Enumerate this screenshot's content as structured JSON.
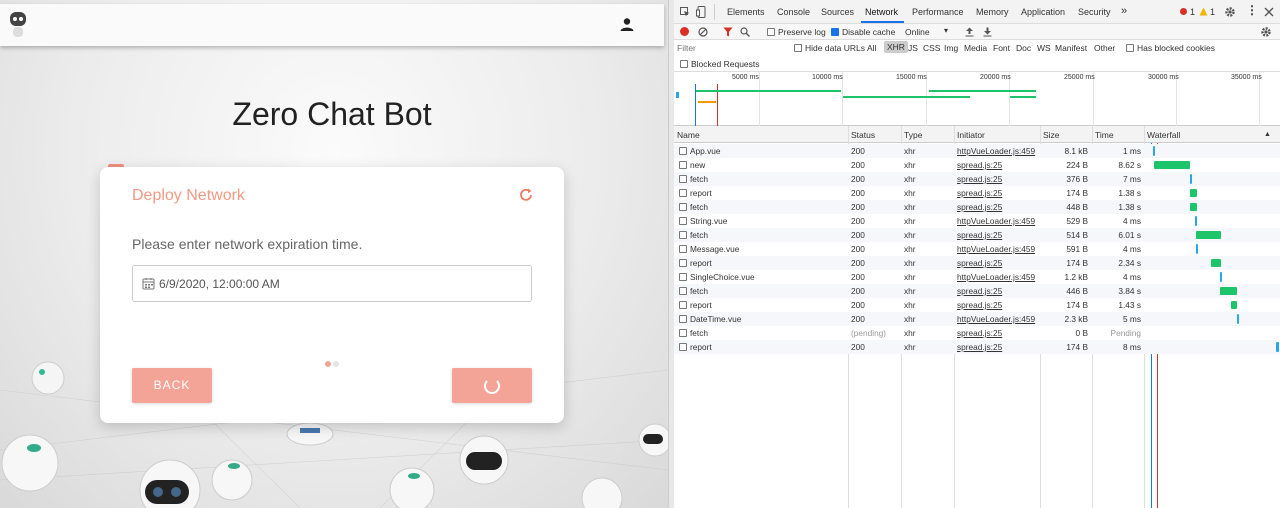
{
  "app": {
    "title": "Zero Chat Bot",
    "card": {
      "title": "Deploy Network",
      "prompt": "Please enter network expiration time.",
      "date_value": "6/9/2020, 12:00:00 AM",
      "back_label": "BACK"
    },
    "accent": "#f4a497",
    "icons": {
      "logo": "robot-logo-icon",
      "user": "person-icon",
      "refresh": "refresh-icon",
      "calendar": "calendar-icon",
      "spinner": "loading-spinner-icon"
    }
  },
  "devtools": {
    "tabs": [
      "Elements",
      "Console",
      "Sources",
      "Network",
      "Performance",
      "Memory",
      "Application",
      "Security"
    ],
    "active_tab": "Network",
    "more": "»",
    "errors": "1",
    "warnings": "1",
    "toolbar": {
      "preserve_log": "Preserve log",
      "disable_cache": "Disable cache",
      "throttle": "Online",
      "disable_cache_checked": true
    },
    "filter": {
      "placeholder": "Filter",
      "hide_data_urls": "Hide data URLs",
      "types": [
        "All",
        "XHR",
        "JS",
        "CSS",
        "Img",
        "Media",
        "Font",
        "Doc",
        "WS",
        "Manifest",
        "Other"
      ],
      "active_type": "XHR",
      "has_blocked_cookies": "Has blocked cookies",
      "blocked_requests": "Blocked Requests"
    },
    "overview_ticks": [
      "5000 ms",
      "10000 ms",
      "15000 ms",
      "20000 ms",
      "25000 ms",
      "30000 ms",
      "35000 ms"
    ],
    "columns": [
      "Name",
      "Status",
      "Type",
      "Initiator",
      "Size",
      "Time",
      "Waterfall"
    ],
    "requests": [
      {
        "name": "App.vue",
        "status": "200",
        "type": "xhr",
        "initiator": "httpVueLoader.js:459",
        "size": "8.1 kB",
        "time": "1 ms"
      },
      {
        "name": "new",
        "status": "200",
        "type": "xhr",
        "initiator": "spread.js:25",
        "size": "224 B",
        "time": "8.62 s"
      },
      {
        "name": "fetch",
        "status": "200",
        "type": "xhr",
        "initiator": "spread.js:25",
        "size": "376 B",
        "time": "7 ms"
      },
      {
        "name": "report",
        "status": "200",
        "type": "xhr",
        "initiator": "spread.js:25",
        "size": "174 B",
        "time": "1.38 s"
      },
      {
        "name": "fetch",
        "status": "200",
        "type": "xhr",
        "initiator": "spread.js:25",
        "size": "448 B",
        "time": "1.38 s"
      },
      {
        "name": "String.vue",
        "status": "200",
        "type": "xhr",
        "initiator": "httpVueLoader.js:459",
        "size": "529 B",
        "time": "4 ms"
      },
      {
        "name": "fetch",
        "status": "200",
        "type": "xhr",
        "initiator": "spread.js:25",
        "size": "514 B",
        "time": "6.01 s"
      },
      {
        "name": "Message.vue",
        "status": "200",
        "type": "xhr",
        "initiator": "httpVueLoader.js:459",
        "size": "591 B",
        "time": "4 ms"
      },
      {
        "name": "report",
        "status": "200",
        "type": "xhr",
        "initiator": "spread.js:25",
        "size": "174 B",
        "time": "2.34 s"
      },
      {
        "name": "SingleChoice.vue",
        "status": "200",
        "type": "xhr",
        "initiator": "httpVueLoader.js:459",
        "size": "1.2 kB",
        "time": "4 ms"
      },
      {
        "name": "fetch",
        "status": "200",
        "type": "xhr",
        "initiator": "spread.js:25",
        "size": "446 B",
        "time": "3.84 s"
      },
      {
        "name": "report",
        "status": "200",
        "type": "xhr",
        "initiator": "spread.js:25",
        "size": "174 B",
        "time": "1.43 s"
      },
      {
        "name": "DateTime.vue",
        "status": "200",
        "type": "xhr",
        "initiator": "httpVueLoader.js:459",
        "size": "2.3 kB",
        "time": "5 ms"
      },
      {
        "name": "fetch",
        "status": "(pending)",
        "type": "xhr",
        "initiator": "spread.js:25",
        "size": "0 B",
        "time": "Pending"
      },
      {
        "name": "report",
        "status": "200",
        "type": "xhr",
        "initiator": "spread.js:25",
        "size": "174 B",
        "time": "8 ms"
      }
    ],
    "colors": {
      "record": "#d93025",
      "waterfall_long": "#1dc46a",
      "waterfall_short": "#2aa5e6",
      "pending": "#999999"
    }
  }
}
